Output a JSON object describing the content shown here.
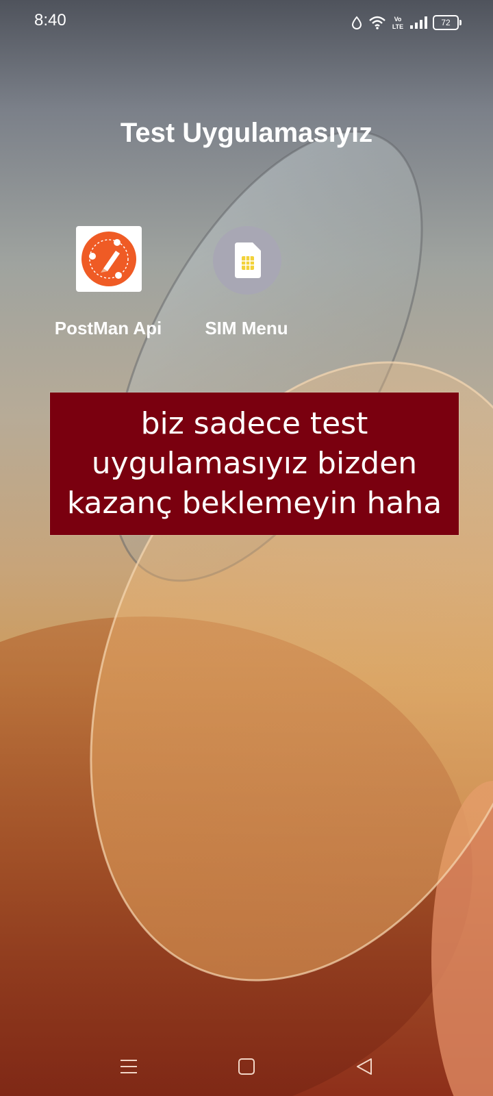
{
  "status_bar": {
    "time": "8:40",
    "network_label": "Vo LTE",
    "battery_level": "72",
    "icons": [
      "data-saver-icon",
      "wifi-icon",
      "volte-icon",
      "signal-icon",
      "battery-icon"
    ]
  },
  "home": {
    "title": "Test Uygulamasıyız",
    "apps": [
      {
        "label": "PostMan Api",
        "icon": "postman-icon",
        "icon_color": "#ef5b25"
      },
      {
        "label": "SIM Menu",
        "icon": "sim-card-icon",
        "icon_color": "#f2d23a"
      }
    ]
  },
  "banner": {
    "lines": [
      "biz sadece test",
      "uygulamasıyız bizden",
      "kazanç beklemeyin haha"
    ],
    "background": "#7a000f"
  },
  "nav_bar": {
    "buttons": [
      "menu-icon",
      "home-icon",
      "back-icon"
    ]
  }
}
